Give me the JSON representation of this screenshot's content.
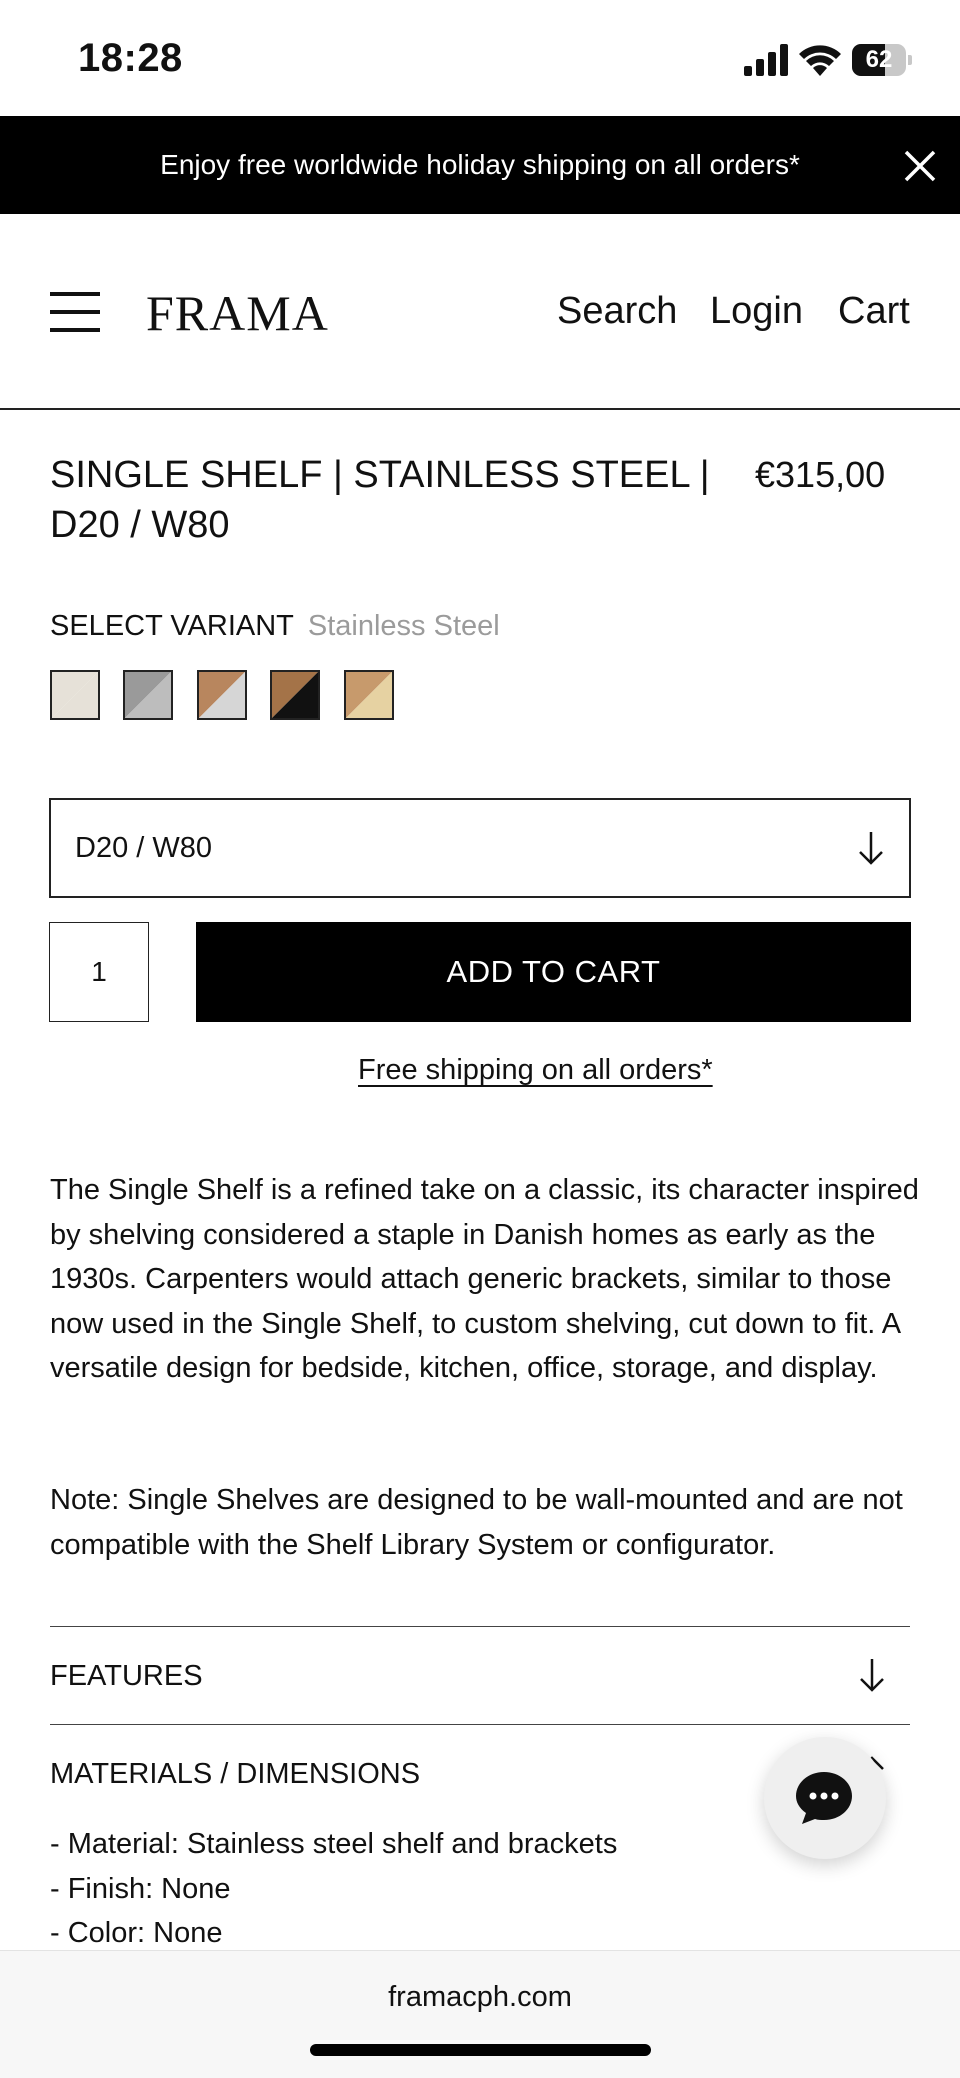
{
  "status_bar": {
    "time": "18:28",
    "battery": "62",
    "battery_level": 0.62
  },
  "banner": {
    "text": "Enjoy free worldwide holiday shipping on all orders*",
    "close_icon": "close-icon"
  },
  "header": {
    "logo": "FRAMA",
    "menu_icon": "hamburger-menu-icon",
    "nav": {
      "search": "Search",
      "login": "Login",
      "cart": "Cart"
    }
  },
  "product": {
    "title": "SINGLE SHELF | STAINLESS STEEL | D20 / W80",
    "price": "€315,00",
    "variant_label": "SELECT VARIANT",
    "variant_value": "Stainless Steel",
    "swatches": [
      {
        "name": "light-grey",
        "colors": [
          "#e6e1d8"
        ]
      },
      {
        "name": "stainless-steel",
        "colors": [
          "#9a9a9a",
          "#bdbdbd"
        ]
      },
      {
        "name": "oak-steel",
        "colors": [
          "#b8865e",
          "#d6d6d6"
        ]
      },
      {
        "name": "oak-black",
        "colors": [
          "#a47348",
          "#111111"
        ]
      },
      {
        "name": "oak-natural",
        "colors": [
          "#c79a6c",
          "#e6d2a2"
        ]
      }
    ],
    "size_select": {
      "value": "D20 / W80",
      "icon": "arrow-down-icon"
    },
    "quantity": "1",
    "add_to_cart": "ADD TO CART",
    "free_shipping": "Free shipping on all orders*",
    "description": "The Single Shelf is a refined take on a classic, its character inspired by shelving considered a staple in Danish homes as early as the 1930s. Carpenters would attach generic brackets, similar to those now used in the Single Shelf, to custom shelving, cut down to fit. A versatile design for bedside, kitchen, office, storage, and display.",
    "note": "Note: Single Shelves are designed to be wall-mounted and are not compatible with the Shelf Library System or configurator."
  },
  "accordions": {
    "features": "FEATURES",
    "materials": "MATERIALS / DIMENSIONS",
    "materials_items": [
      "- Material: Stainless steel shelf and brackets",
      "- Finish: None",
      "- Color: None"
    ]
  },
  "chat": {
    "icon": "chat-bubble-icon"
  },
  "browser": {
    "url": "framacph.com"
  }
}
